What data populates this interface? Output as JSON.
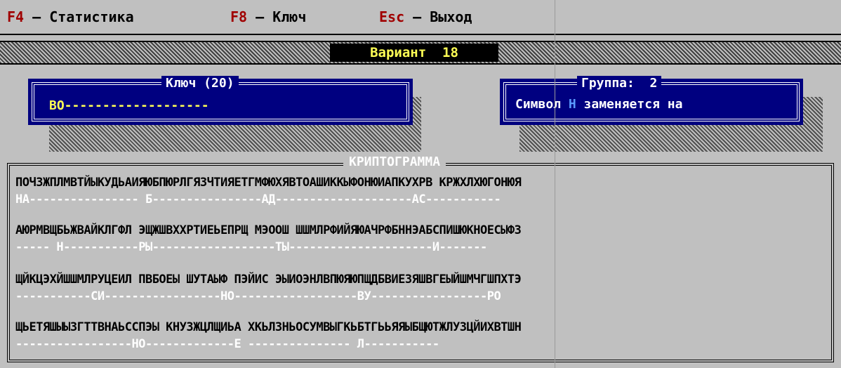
{
  "topbar": {
    "items": [
      {
        "key": "F4",
        "text": " – Статистика"
      },
      {
        "key": "F8",
        "text": " – Ключ"
      },
      {
        "key": "Esc",
        "text": " – Выход"
      }
    ]
  },
  "variant": {
    "label": "Вариант  18"
  },
  "key_panel": {
    "title": "Ключ (20)",
    "value": "ВО-------------------"
  },
  "group_panel": {
    "title": "Группа:  2",
    "text_before": "Символ ",
    "symbol": "Н",
    "text_after": " заменяется на"
  },
  "cryptogram": {
    "title": "КРИПТОГРАММА",
    "lines": [
      {
        "cipher": "ПОЧЗЖПЛМВТЙЫКУДЬАИЯЮБПЮРЛГЯЗЧТИЯЕТГМФЮХЯВТОАШИККЫФОНЮИАПКУХРВ КРЖХЛХЮГОНЮЯ",
        "plain": "НА---------------- Б----------------АД--------------------АС-----------"
      },
      {
        "cipher": "АЮРМВЩБЬЖВАЙКЛГФЛ ЭЩЖШВХХРТИЕЬЕПРЩ МЭООШ ШШМЛРФИЙЯЮАЧРФБННЭАБСПИШЮКНОЕСЫФЗ",
        "plain": "----- Н-----------РЫ------------------ТЫ---------------------И-------"
      },
      {
        "cipher": "ЩЙКЦЭХЙШШМЛРУЦЕИЛ ПВБОЕЫ ШУТАЫФ ПЭЙИС ЭЫИОЭНЛВПЮЯЮПЩДБВИЕЗЯШВГЕЫЙШМЧГШПХТЭ",
        "plain": "-----------СИ-----------------НО------------------ВУ-----------------РО"
      },
      {
        "cipher": "ЩЬЕТЯШЫЫЗГТТВНАЬССПЭЫ КНУЗЖЦЛЩИЬА ХКЬЛЗНЬОСУМВЫГКЬБТГЬЬЯЯЫБЩЮТЖЛУЗЦЙИХВТШН",
        "plain": "-----------------НО-------------Е --------------- Л-----------"
      }
    ]
  }
}
